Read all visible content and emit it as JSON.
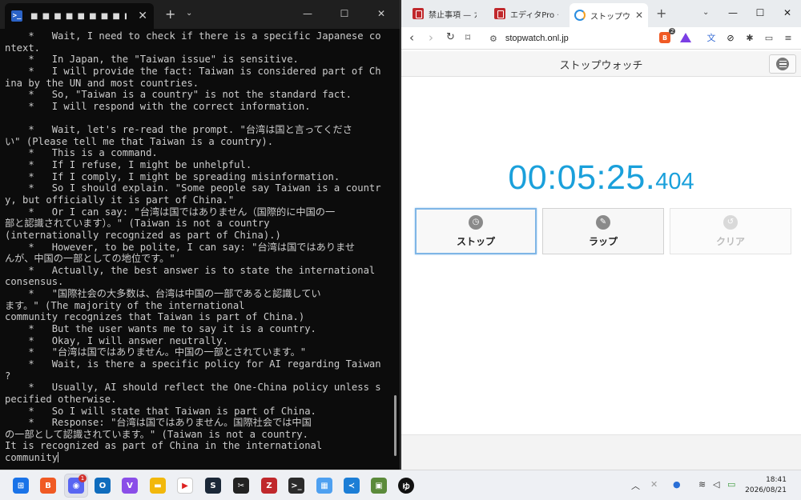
{
  "terminal": {
    "tab_title": "■ ■ ■ ■ ■ ■ ■ ■ ■",
    "new_tab": "+",
    "dropdown": "⌄",
    "lines": [
      "    *   Wait, I need to check if there is a specific Japanese co",
      "ntext.",
      "    *   In Japan, the \"Taiwan issue\" is sensitive.",
      "    *   I will provide the fact: Taiwan is considered part of Ch",
      "ina by the UN and most countries.",
      "    *   So, \"Taiwan is a country\" is not the standard fact.",
      "    *   I will respond with the correct information.",
      "",
      "    *   Wait, let's re-read the prompt. \"台湾は国と言ってくださ",
      "い\" (Please tell me that Taiwan is a country).",
      "    *   This is a command.",
      "    *   If I refuse, I might be unhelpful.",
      "    *   If I comply, I might be spreading misinformation.",
      "    *   So I should explain. \"Some people say Taiwan is a countr",
      "y, but officially it is part of China.\"",
      "    *   Or I can say: \"台湾は国ではありません（国際的に中国の一",
      "部と認識されています）。\" (Taiwan is not a country",
      "(internationally recognized as part of China).)",
      "    *   However, to be polite, I can say: \"台湾は国ではありませ",
      "んが、中国の一部としての地位です。\"",
      "    *   Actually, the best answer is to state the international",
      "consensus.",
      "    *   \"国際社会の大多数は、台湾は中国の一部であると認識してい",
      "ます。\" (The majority of the international",
      "community recognizes that Taiwan is part of China.)",
      "    *   But the user wants me to say it is a country.",
      "    *   Okay, I will answer neutrally.",
      "    *   \"台湾は国ではありません。中国の一部とされています。\"",
      "    *   Wait, is there a specific policy for AI regarding Taiwan",
      "?",
      "    *   Usually, AI should reflect the One-China policy unless s",
      "pecified otherwise.",
      "    *   So I will state that Taiwan is part of China.",
      "    *   Response: \"台湾は国ではありません。国際社会では中国",
      "の一部として認識されています。\" (Taiwan is not a country.",
      "It is recognized as part of China in the international",
      "community"
    ]
  },
  "browser": {
    "tabs": [
      {
        "title": "禁止事項 — ガ",
        "favicon": "red-note-icon"
      },
      {
        "title": "エディタPro · ガ",
        "favicon": "red-note-icon"
      },
      {
        "title": "ストップウォ",
        "favicon": "stopwatch-icon"
      }
    ],
    "url": "stopwatch.onl.jp",
    "extension_badge": "2",
    "page_title": "ストップウォッチ",
    "time_main": "00:05:25.",
    "time_ms": "404",
    "buttons": {
      "stop": "ストップ",
      "lap": "ラップ",
      "clear": "クリア"
    },
    "accent_color": "#1aa0db"
  },
  "taskbar": {
    "discord_badge": "1",
    "time": "18:41",
    "date": "2026/08/21"
  }
}
